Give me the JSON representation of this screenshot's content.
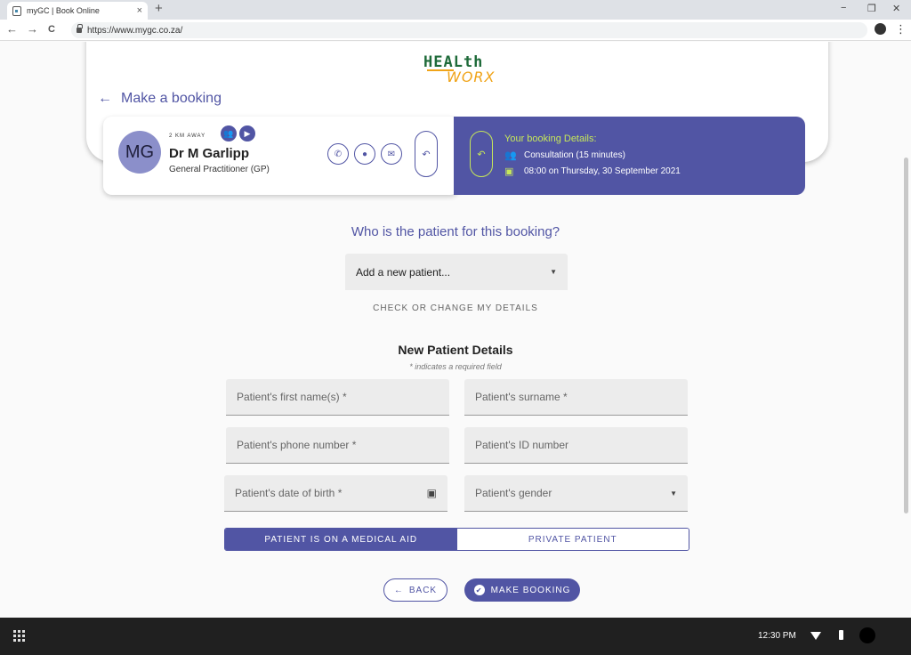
{
  "browser": {
    "tab_title": "myGC | Book Online",
    "tab_close": "×",
    "new_tab": "+",
    "url": "https://www.mygc.co.za/",
    "back": "←",
    "forward": "→",
    "reload": "C",
    "menu": "⋮",
    "minimize": "−",
    "restore": "❐",
    "close": "✕"
  },
  "logo": {
    "line1": "HEALth",
    "line2": "WORX"
  },
  "header": {
    "back_arrow": "←",
    "title": "Make a booking"
  },
  "doctor": {
    "initials": "MG",
    "distance": "2 KM AWAY",
    "name": "Dr M Garlipp",
    "role": "General Practitioner (GP)"
  },
  "booking": {
    "title": "Your booking Details:",
    "consultation": "Consultation (15 minutes)",
    "datetime": "08:00 on Thursday, 30 September 2021"
  },
  "patient_select": {
    "question": "Who is the patient for this booking?",
    "selected": "Add a new patient...",
    "check_details": "CHECK OR CHANGE MY DETAILS"
  },
  "form": {
    "title": "New Patient Details",
    "required_note": "* indicates a required field",
    "first_name": "Patient's first name(s) *",
    "surname": "Patient's surname *",
    "phone": "Patient's phone number *",
    "id_number": "Patient's ID number",
    "dob": "Patient's date of birth *",
    "gender": "Patient's gender"
  },
  "payment_toggle": {
    "medical_aid": "PATIENT IS ON A MEDICAL AID",
    "private": "PRIVATE PATIENT",
    "selected": "medical_aid"
  },
  "actions": {
    "back": "BACK",
    "make_booking": "MAKE BOOKING"
  },
  "taskbar": {
    "time": "12:30 PM"
  },
  "colors": {
    "brand": "#5155a4",
    "accent": "#c6e75a"
  }
}
